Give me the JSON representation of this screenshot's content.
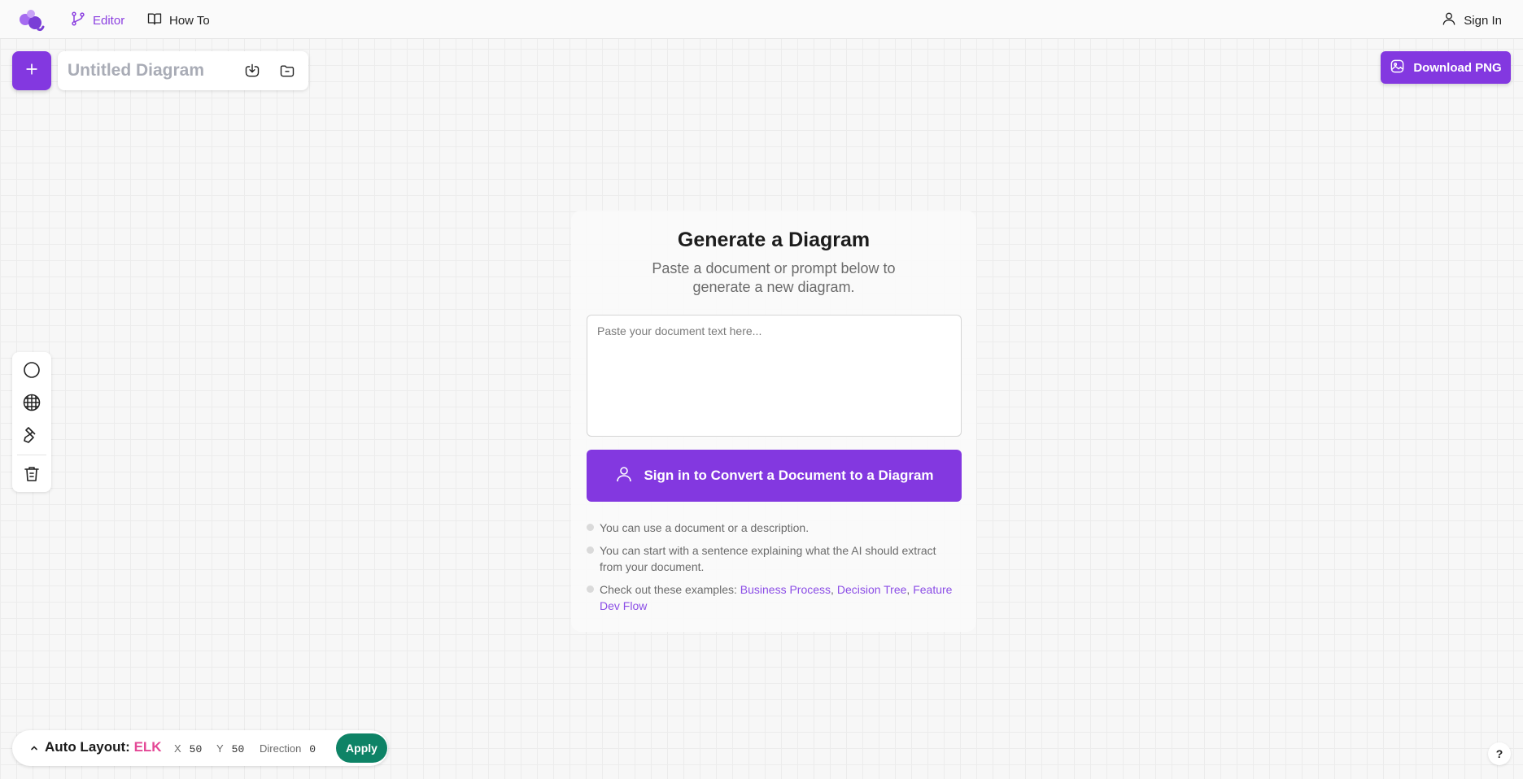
{
  "topbar": {
    "logo_icon": "app-logo-icon",
    "nav": [
      {
        "label": "Editor",
        "icon": "git-branch-icon",
        "active": true
      },
      {
        "label": "How To",
        "icon": "book-open-icon",
        "active": false
      }
    ],
    "signin_label": "Sign In",
    "signin_icon": "user-icon"
  },
  "file_bar": {
    "new_icon": "plus-icon",
    "title_placeholder": "Untitled Diagram",
    "title_value": "",
    "download_icon": "download-icon",
    "open_icon": "folder-open-icon"
  },
  "download_png": {
    "label": "Download PNG",
    "icon": "image-icon"
  },
  "palette": {
    "tools": [
      {
        "name": "circle-icon"
      },
      {
        "name": "grid-globe-icon"
      },
      {
        "name": "brush-icon"
      },
      {
        "name": "trash-icon"
      }
    ]
  },
  "generator": {
    "title": "Generate a Diagram",
    "subtitle": "Paste a document or prompt below to generate a new diagram.",
    "textarea_placeholder": "Paste your document text here...",
    "textarea_value": "",
    "convert_label": "Sign in to Convert a Document to a Diagram",
    "convert_icon": "user-icon",
    "tips": {
      "tip1": "You can use a document or a description.",
      "tip2": "You can start with a sentence explaining what the AI should extract from your document.",
      "tip3_prefix": "Check out these examples: ",
      "examples": [
        "Business Process",
        "Decision Tree",
        "Feature Dev Flow"
      ],
      "separator": ","
    }
  },
  "auto_layout": {
    "label": "Auto Layout:",
    "engine": "ELK",
    "x_label": "X",
    "x_value": "50",
    "y_label": "Y",
    "y_value": "50",
    "direction_label": "Direction",
    "direction_value": "0",
    "apply_label": "Apply"
  },
  "help_label": "?",
  "colors": {
    "accent": "#8338e0",
    "apply": "#0e8366",
    "engine": "#e44896"
  }
}
